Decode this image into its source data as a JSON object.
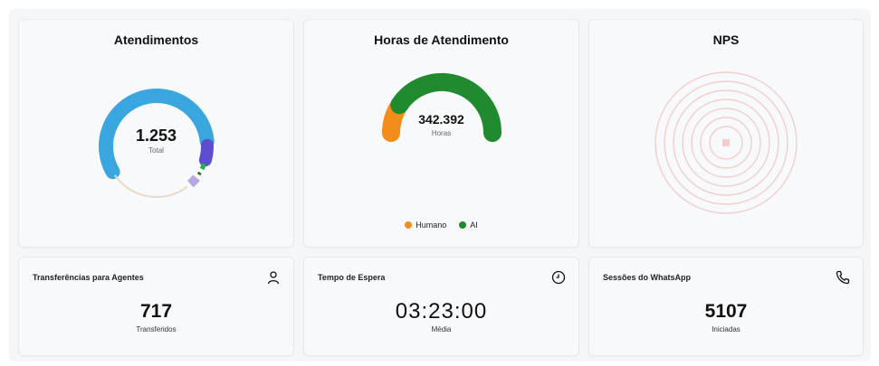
{
  "cards": {
    "atendimentos": {
      "title": "Atendimentos",
      "total_value": "1.253",
      "total_label": "Total"
    },
    "horas": {
      "title": "Horas de Atendimento",
      "value": "342.392",
      "value_label": "Horas",
      "legend": [
        {
          "label": "Humano",
          "color": "#f28c1a"
        },
        {
          "label": "AI",
          "color": "#1f8a2e"
        }
      ]
    },
    "nps": {
      "title": "NPS"
    },
    "transferencias": {
      "title": "Transferências para Agentes",
      "value": "717",
      "label": "Transferidos",
      "icon": "user-icon"
    },
    "espera": {
      "title": "Tempo de Espera",
      "value": "03:23:00",
      "label": "Média",
      "icon": "clock-icon"
    },
    "whatsapp": {
      "title": "Sessões do WhatsApp",
      "value": "5107",
      "label": "Iniciadas",
      "icon": "phone-icon"
    }
  },
  "chart_data": [
    {
      "type": "pie",
      "variant": "donut",
      "segments_colors": [
        "#3aa6e0",
        "#5b4fcf",
        "#22b24c",
        "#2f6b12",
        "#b7a8e0",
        "#e9d9c8"
      ],
      "segment_values": [
        58,
        6,
        3,
        2,
        4,
        27
      ]
    },
    {
      "type": "pie",
      "variant": "half-gauge",
      "series": [
        {
          "name": "Humano",
          "color": "#f28c1a",
          "value": 0.17
        },
        {
          "name": "AI",
          "color": "#1f8a2e",
          "value": 0.83
        }
      ]
    },
    {
      "type": "pie",
      "variant": "empty-radial",
      "color": "#f3c6c6"
    }
  ]
}
